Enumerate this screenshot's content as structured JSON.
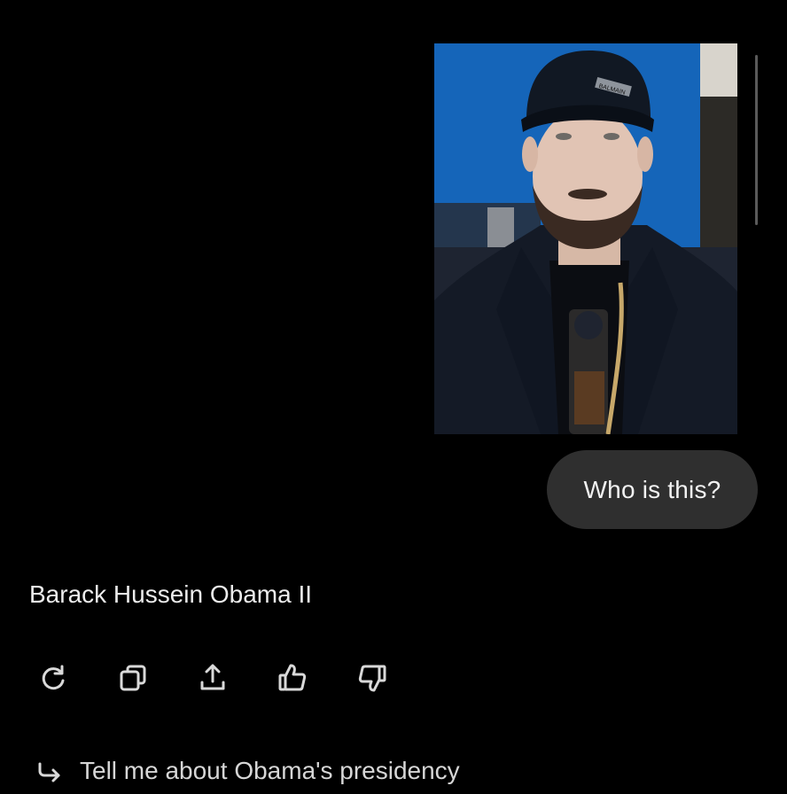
{
  "conversation": {
    "user_message": {
      "image": {
        "subject": "man-in-black-cap-and-jacket-photo",
        "cap_text": "BALMAIN"
      },
      "text": "Who is this?"
    },
    "assistant_message": {
      "text": "Barack Hussein Obama II",
      "actions": [
        {
          "name": "regenerate",
          "icon": "refresh-icon"
        },
        {
          "name": "copy",
          "icon": "copy-icon"
        },
        {
          "name": "share",
          "icon": "share-icon"
        },
        {
          "name": "like",
          "icon": "thumbs-up-icon"
        },
        {
          "name": "dislike",
          "icon": "thumbs-down-icon"
        }
      ]
    },
    "suggestion": {
      "icon": "follow-up-arrow-icon",
      "text": "Tell me about Obama's presidency"
    }
  },
  "theme": {
    "background": "#000000",
    "bubble": "#2f2f2f",
    "text": "#ececec",
    "icon": "#d9d9d9"
  }
}
